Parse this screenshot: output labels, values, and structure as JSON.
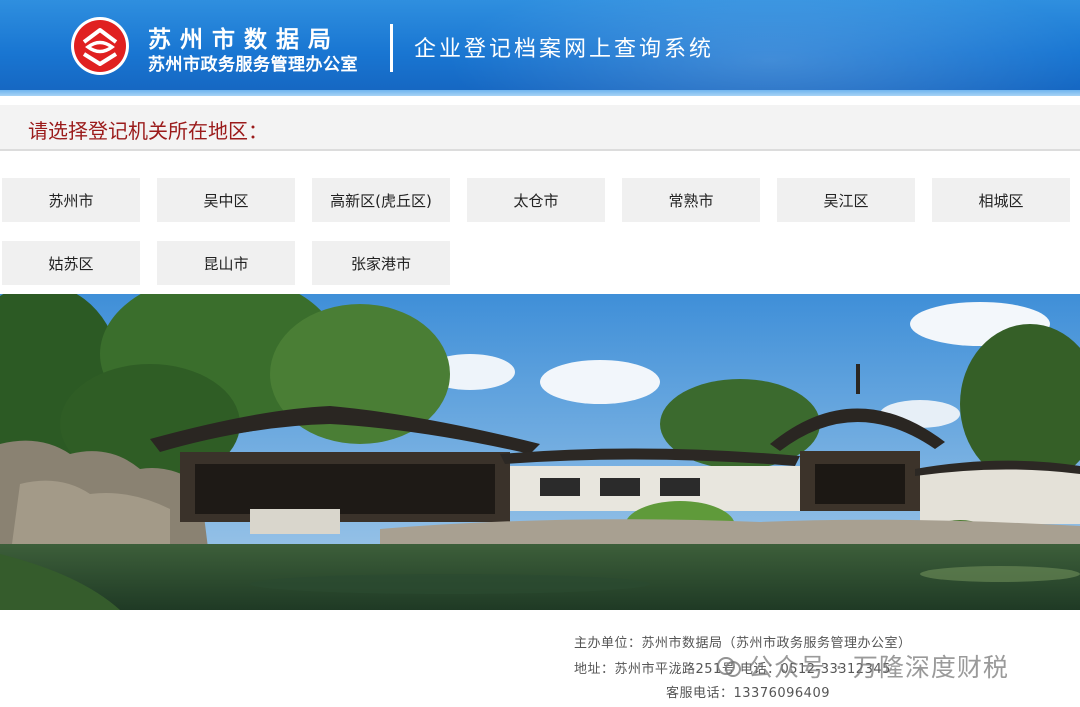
{
  "header": {
    "org_name": "苏州市数据局",
    "org_sub": "苏州市政务服务管理办公室",
    "system_title": "企业登记档案网上查询系统"
  },
  "section": {
    "title": "请选择登记机关所在地区："
  },
  "regions": [
    "苏州市",
    "吴中区",
    "高新区(虎丘区)",
    "太仓市",
    "常熟市",
    "吴江区",
    "相城区",
    "姑苏区",
    "昆山市",
    "张家港市"
  ],
  "footer": {
    "host_line": "主办单位：苏州市数据局（苏州市政务服务管理办公室）",
    "address_line": "地址：苏州市平泷路251号   电话：0512-33312345",
    "service_line": "客服电话：13376096409"
  },
  "watermark": {
    "text": "公众号 · 万隆深度财税"
  },
  "colors": {
    "header_blue": "#1976d2",
    "logo_red": "#e02020",
    "section_title": "#9b1b1b"
  }
}
